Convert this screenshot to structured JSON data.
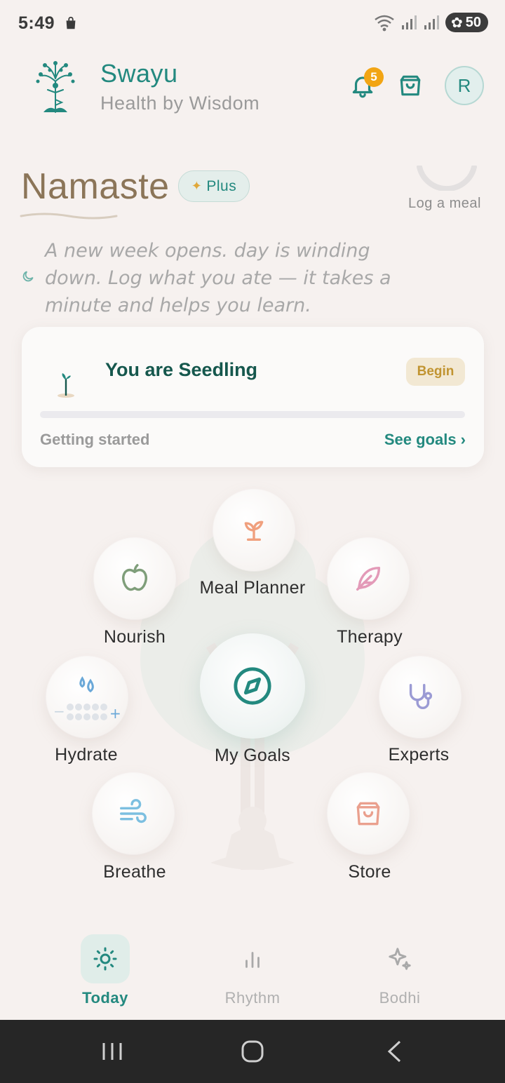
{
  "status_bar": {
    "time": "5:49",
    "battery": "50"
  },
  "header": {
    "brand_name": "Swayu",
    "brand_tagline": "Health by Wisdom",
    "notification_count": "5",
    "avatar_initial": "R"
  },
  "greeting": {
    "title": "Namaste",
    "plan_badge": "Plus",
    "log_meal_label": "Log a meal",
    "message": "A new week opens. day is winding down. Log what you ate — it takes a minute and helps you learn."
  },
  "level_card": {
    "title": "You are Seedling",
    "badge": "Begin",
    "progress_fraction": 0.0,
    "status": "Getting started",
    "link": "See goals ›"
  },
  "features": {
    "meal_planner": "Meal Planner",
    "nourish": "Nourish",
    "therapy": "Therapy",
    "hydrate": "Hydrate",
    "my_goals": "My Goals",
    "experts": "Experts",
    "breathe": "Breathe",
    "store": "Store"
  },
  "bottom_nav": {
    "items": [
      {
        "label": "Today",
        "active": true
      },
      {
        "label": "Rhythm",
        "active": false
      },
      {
        "label": "Bodhi",
        "active": false
      }
    ]
  },
  "colors": {
    "accent": "#23897f",
    "greeting": "#8b7558",
    "badge": "#f2a514",
    "background": "#f6f1ef"
  }
}
